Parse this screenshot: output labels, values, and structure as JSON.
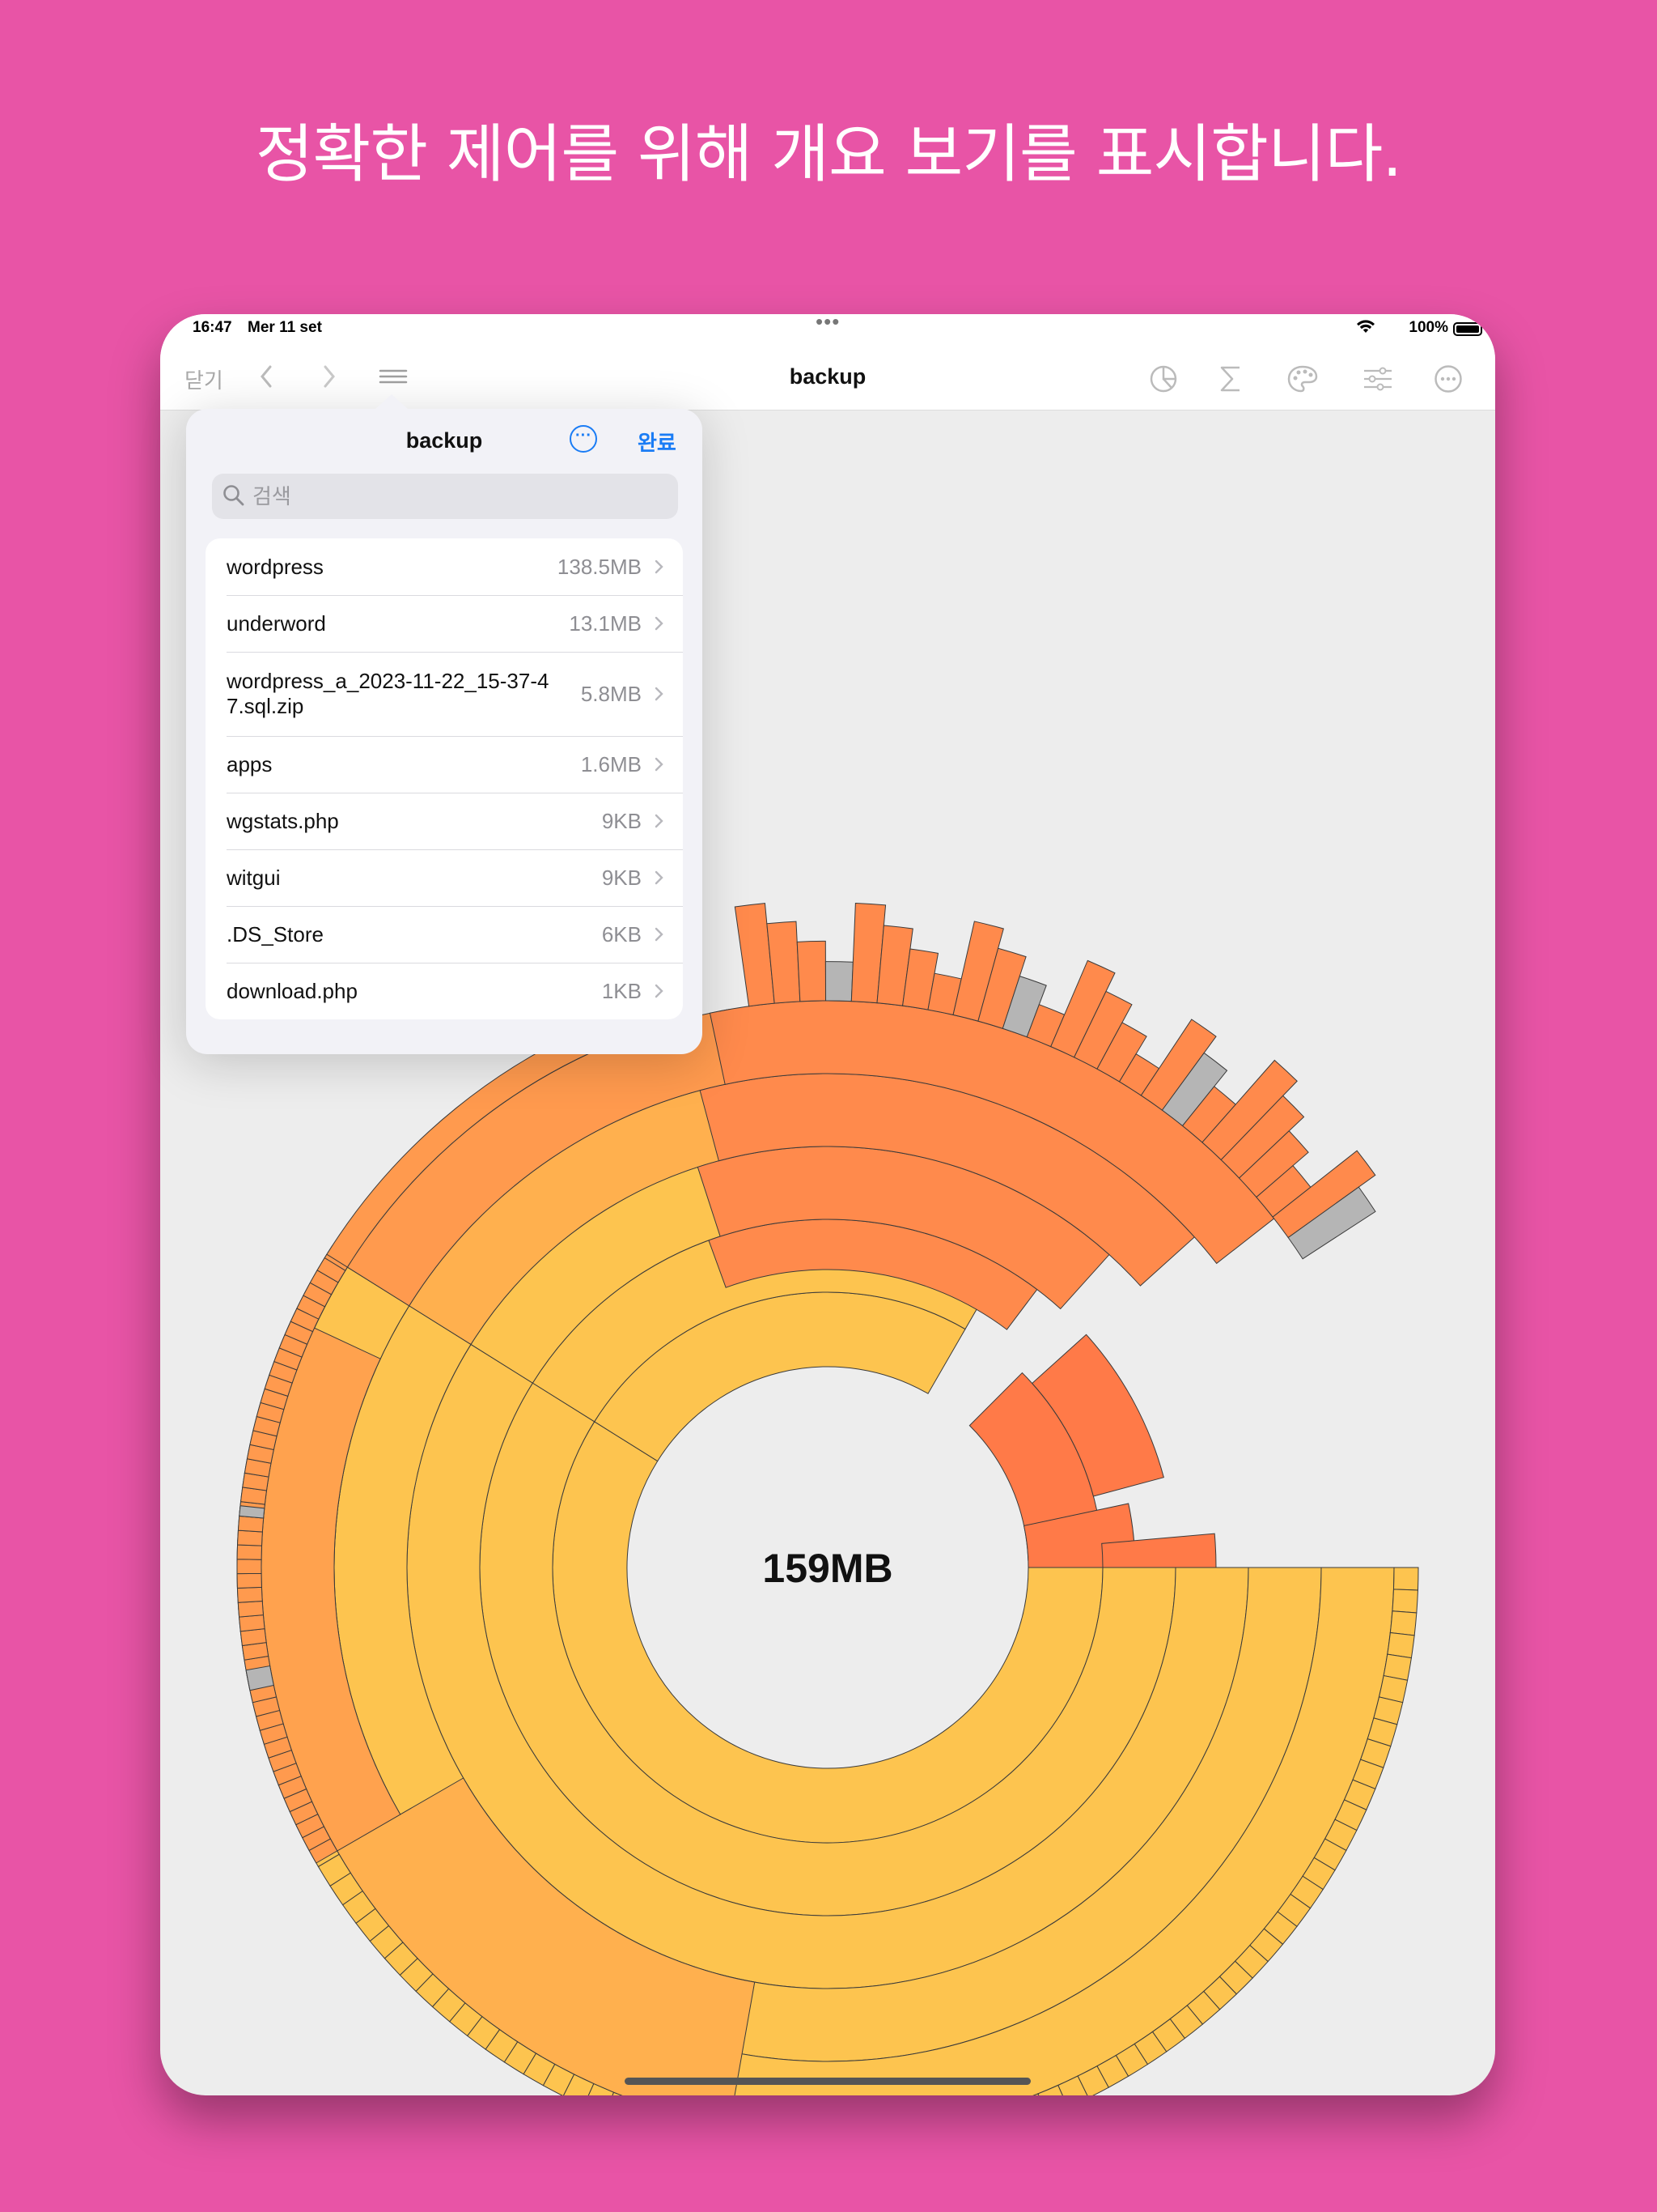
{
  "headline": "정확한 제어를 위해 개요 보기를 표시합니다.",
  "status_bar": {
    "time": "16:47",
    "date": "Mer 11 set",
    "battery": "100%"
  },
  "toolbar": {
    "close_label": "닫기",
    "title": "backup"
  },
  "popover": {
    "title": "backup",
    "done_label": "완료",
    "search_placeholder": "검색",
    "items": [
      {
        "name": "wordpress",
        "size": "138.5MB"
      },
      {
        "name": "underword",
        "size": "13.1MB"
      },
      {
        "name": "wordpress_a_2023-11-22_15-37-47.sql.zip",
        "size": "5.8MB"
      },
      {
        "name": "apps",
        "size": "1.6MB"
      },
      {
        "name": "wgstats.php",
        "size": "9KB"
      },
      {
        "name": "witgui",
        "size": "9KB"
      },
      {
        "name": ".DS_Store",
        "size": "6KB"
      },
      {
        "name": "download.php",
        "size": "1KB"
      }
    ]
  },
  "chart_data": {
    "type": "sunburst",
    "total_label": "159MB",
    "colors": {
      "yellow": "#FDC44F",
      "orange": "#FF8A4C",
      "red_orange": "#FF7A48",
      "gray": "#B5B5B5",
      "stroke": "#3A3A3A"
    }
  }
}
